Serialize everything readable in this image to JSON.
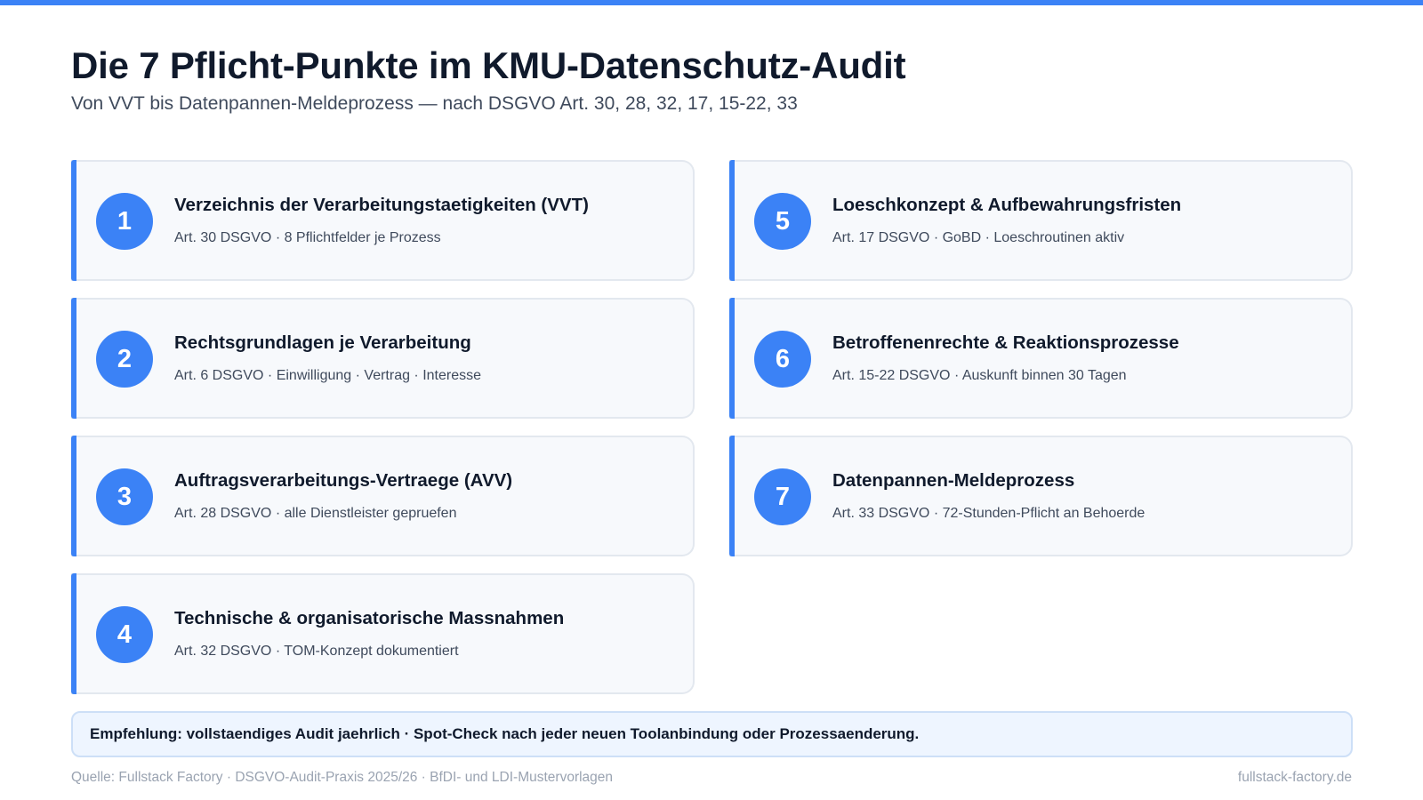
{
  "page": {
    "title": "Die 7 Pflicht-Punkte im KMU-Datenschutz-Audit",
    "subtitle": "Von VVT bis Datenpannen-Meldeprozess — nach DSGVO Art. 30, 28, 32, 17, 15-22, 33"
  },
  "colors": {
    "accent": "#3b82f6",
    "card_background": "#f7f9fc",
    "recommendation_background": "#eef5ff"
  },
  "items": [
    {
      "number": "1",
      "title": "Verzeichnis der Verarbeitungstaetigkeiten (VVT)",
      "details": "Art. 30 DSGVO · 8 Pflichtfelder je Prozess"
    },
    {
      "number": "2",
      "title": "Rechtsgrundlagen je Verarbeitung",
      "details": "Art. 6 DSGVO · Einwilligung · Vertrag · Interesse"
    },
    {
      "number": "3",
      "title": "Auftragsverarbeitungs-Vertraege (AVV)",
      "details": "Art. 28 DSGVO · alle Dienstleister gepruefen"
    },
    {
      "number": "4",
      "title": "Technische & organisatorische Massnahmen",
      "details": "Art. 32 DSGVO · TOM-Konzept dokumentiert"
    },
    {
      "number": "5",
      "title": "Loeschkonzept & Aufbewahrungsfristen",
      "details": "Art. 17 DSGVO · GoBD · Loeschroutinen aktiv"
    },
    {
      "number": "6",
      "title": "Betroffenenrechte & Reaktionsprozesse",
      "details": "Art. 15-22 DSGVO · Auskunft binnen 30 Tagen"
    },
    {
      "number": "7",
      "title": "Datenpannen-Meldeprozess",
      "details": "Art. 33 DSGVO · 72-Stunden-Pflicht an Behoerde"
    }
  ],
  "recommendation": "Empfehlung: vollstaendiges Audit jaehrlich · Spot-Check nach jeder neuen Toolanbindung oder Prozessaenderung.",
  "footer": {
    "source": "Quelle: Fullstack Factory · DSGVO-Audit-Praxis 2025/26 · BfDI- und LDI-Mustervorlagen",
    "website": "fullstack-factory.de"
  }
}
